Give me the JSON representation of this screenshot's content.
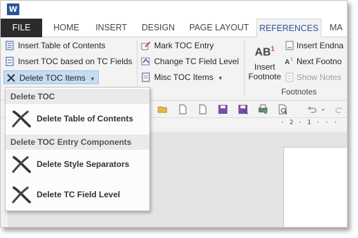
{
  "titlebar": {
    "app_icon_letter": "W"
  },
  "tabs": [
    {
      "label": "FILE"
    },
    {
      "label": "HOME"
    },
    {
      "label": "INSERT"
    },
    {
      "label": "DESIGN"
    },
    {
      "label": "PAGE LAYOUT"
    },
    {
      "label": "REFERENCES"
    },
    {
      "label": "MA"
    }
  ],
  "ribbon": {
    "toc_group": {
      "insert_toc": "Insert Table of Contents",
      "insert_toc_tc": "Insert TOC based on TC Fields",
      "delete_toc_items": "Delete TOC Items",
      "group_label_fragment": "s"
    },
    "entry_group": {
      "mark_toc_entry": "Mark TOC Entry",
      "change_tc_field_level": "Change TC Field Level",
      "misc_toc_items": "Misc TOC Items"
    },
    "footnotes_group": {
      "insert_footnote_line1": "Insert",
      "insert_footnote_line2": "Footnote",
      "insert_endnote": "Insert Endna",
      "next_footnote": "Next Footno",
      "show_notes": "Show Notes",
      "group_label": "Footnotes",
      "ab_glyph": "AB",
      "ab_sup": "1"
    }
  },
  "ruler_text": "· 2 · 1 · · ·",
  "dropdown": {
    "section1_header": "Delete TOC",
    "item_delete_toc": "Delete Table of Contents",
    "section2_header": "Delete TOC Entry Components",
    "item_delete_separators": "Delete Style Separators",
    "item_delete_tc_level": "Delete TC Field Level"
  },
  "colors": {
    "accent": "#2b579a",
    "file_tab": "#2b2b2b",
    "highlight": "#c5dcf3",
    "word_blue": "#2b5797"
  }
}
